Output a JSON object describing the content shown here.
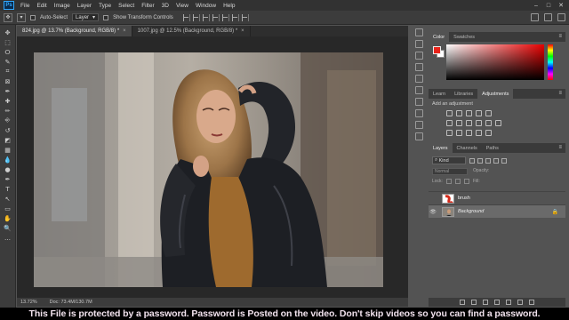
{
  "app": {
    "logo": "Ps"
  },
  "menu": [
    "File",
    "Edit",
    "Image",
    "Layer",
    "Type",
    "Select",
    "Filter",
    "3D",
    "View",
    "Window",
    "Help"
  ],
  "window_controls": {
    "minimize": "–",
    "maximize": "□",
    "close": "✕"
  },
  "options_bar": {
    "auto_select_label": "Auto-Select",
    "auto_select_target": "Layer",
    "transform_label": "Show Transform Controls"
  },
  "tools": [
    "move-tool",
    "marquee-tool",
    "lasso-tool",
    "quick-select-tool",
    "crop-tool",
    "frame-tool",
    "eyedropper-tool",
    "healing-tool",
    "brush-tool",
    "stamp-tool",
    "history-brush-tool",
    "eraser-tool",
    "gradient-tool",
    "blur-tool",
    "dodge-tool",
    "pen-tool",
    "type-tool",
    "path-select-tool",
    "rectangle-tool",
    "hand-tool",
    "zoom-tool",
    "more-tools"
  ],
  "tool_glyphs": [
    "✥",
    "⬚",
    "ⵔ",
    "✎",
    "⌗",
    "⊠",
    "✒",
    "✚",
    "✏",
    "⎆",
    "↺",
    "◩",
    "▦",
    "💧",
    "●",
    "✒",
    "T",
    "↖",
    "▭",
    "✋",
    "🔍",
    "…"
  ],
  "colors": {
    "foreground": "#d42a1a",
    "background": "#ffffff",
    "accent": "#31a8ff"
  },
  "doc_tabs": [
    {
      "label": "824.jpg @ 13.7% (Background, RGB/8) *",
      "close": "×",
      "active": true
    },
    {
      "label": "1007.jpg @ 12.5% (Background, RGB/8) *",
      "close": "×",
      "active": false
    }
  ],
  "status": {
    "zoom": "13.72%",
    "doc": "Doc: 73.4M/130.7M"
  },
  "color_panel": {
    "tabs": [
      "Color",
      "Swatches"
    ],
    "menu": "≡"
  },
  "adjustments_panel": {
    "tabs": [
      "Learn",
      "Libraries",
      "Adjustments"
    ],
    "menu": "≡",
    "title": "Add an adjustment"
  },
  "layers_panel": {
    "tabs": [
      "Layers",
      "Channels",
      "Paths"
    ],
    "menu": "≡",
    "kind": "Kind",
    "blend_mode": "Normal",
    "opacity_label": "Opacity:",
    "lock_label": "Lock:",
    "fill_label": "Fill:",
    "layers": [
      {
        "name": "brush",
        "visible": false,
        "selected": false,
        "italic": false
      },
      {
        "name": "Background",
        "visible": true,
        "selected": true,
        "italic": true,
        "locked": true
      }
    ],
    "eye_glyph": "👁",
    "lock_glyph": "🔒"
  },
  "caption": "This File is protected by a password. Password is Posted on the video. Don't skip videos so you can find a password."
}
